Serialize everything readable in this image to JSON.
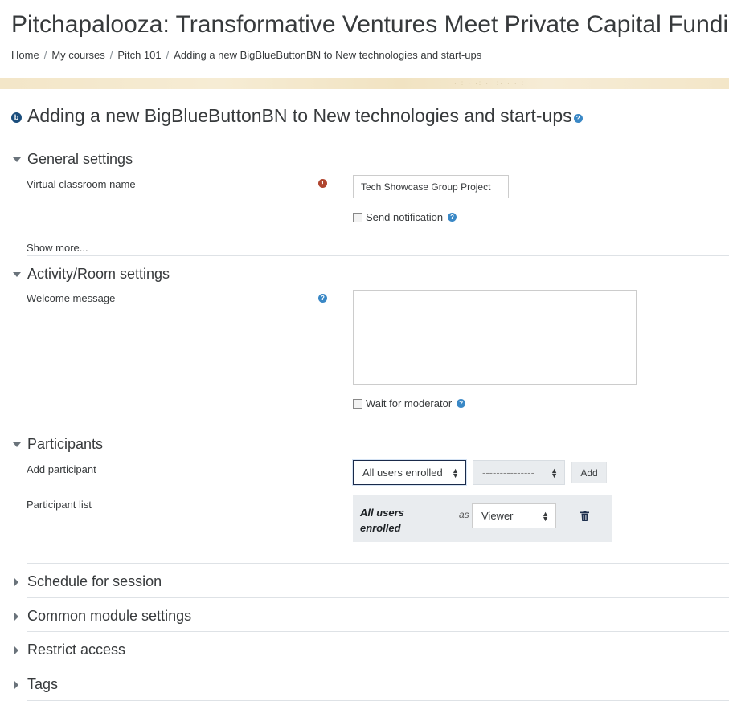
{
  "page": {
    "title": "Pitchapalooza: Transformative Ventures Meet Private Capital Funding",
    "breadcrumb": [
      "Home",
      "My courses",
      "Pitch 101",
      "Adding a new BigBlueButtonBN to New technologies and start-ups"
    ],
    "breadcrumb_separator": "/",
    "heading": "Adding a new BigBlueButtonBN to New technologies and start-ups",
    "heading_icon": "bigbluebutton-icon",
    "help_glyph": "?",
    "required_glyph": "!",
    "bbb_glyph": "b"
  },
  "general": {
    "title": "General settings",
    "name_label": "Virtual classroom name",
    "name_value": "Tech Showcase Group Project",
    "send_notification_label": "Send notification",
    "send_notification_checked": false,
    "show_more": "Show more..."
  },
  "activity": {
    "title": "Activity/Room settings",
    "welcome_label": "Welcome message",
    "welcome_value": "",
    "wait_moderator_label": "Wait for moderator",
    "wait_moderator_checked": false
  },
  "participants": {
    "title": "Participants",
    "add_label": "Add participant",
    "add_select_value": "All users enrolled",
    "add_select2_value": "---------------",
    "add_button": "Add",
    "list_label": "Participant list",
    "list_name": "All users enrolled",
    "list_as": "as",
    "list_role": "Viewer"
  },
  "collapsed_sections": [
    "Schedule for session",
    "Common module settings",
    "Restrict access",
    "Tags"
  ],
  "colors": {
    "help": "#3a88c6",
    "required": "#b0452f",
    "bbb_logo": "#1a4d7c",
    "banner": "#f3e6c8"
  }
}
